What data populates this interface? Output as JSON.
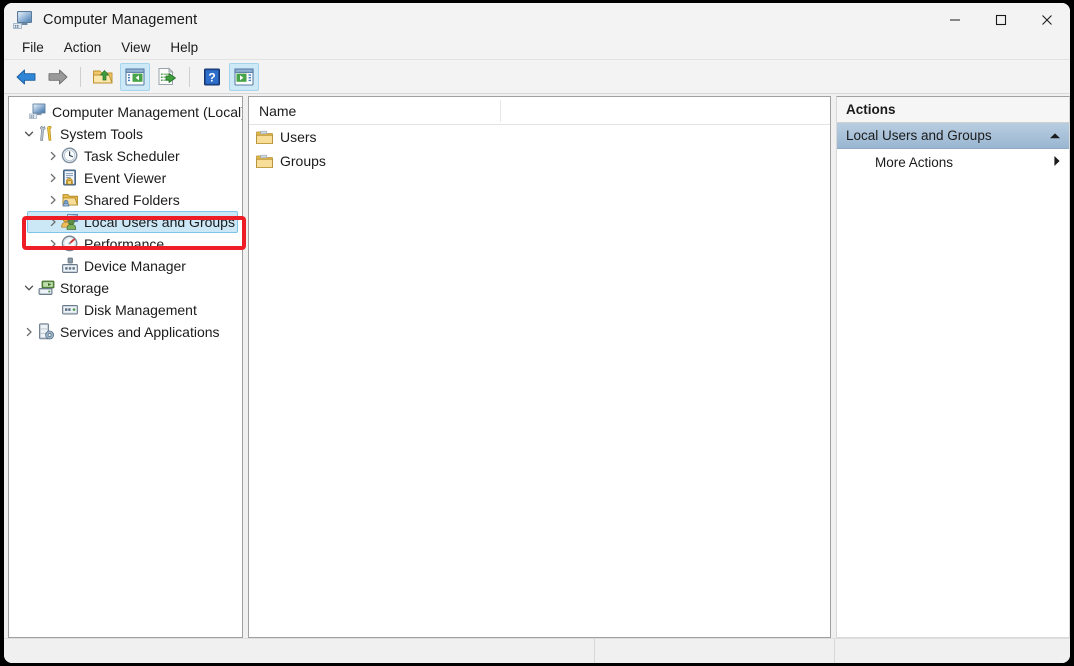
{
  "window": {
    "title": "Computer Management",
    "app_icon": "computer-management-icon",
    "controls": {
      "minimize": "—",
      "maximize": "□",
      "close": "✕"
    }
  },
  "menubar": {
    "items": [
      {
        "label": "File"
      },
      {
        "label": "Action"
      },
      {
        "label": "View"
      },
      {
        "label": "Help"
      }
    ]
  },
  "toolbar": {
    "buttons": [
      {
        "name": "back-icon",
        "active": false
      },
      {
        "name": "forward-icon",
        "active": false
      },
      {
        "name": "up-folder-icon",
        "active": false
      },
      {
        "name": "show-hide-console-tree-icon",
        "active": true
      },
      {
        "name": "export-list-icon",
        "active": false
      },
      {
        "name": "help-icon",
        "active": false
      },
      {
        "name": "show-hide-action-pane-icon",
        "active": true
      }
    ]
  },
  "tree": {
    "nodes": [
      {
        "label": "Computer Management (Local)",
        "icon": "computer-icon",
        "depth": 0,
        "twist": "none",
        "selected": false
      },
      {
        "label": "System Tools",
        "icon": "system-tools-icon",
        "depth": 1,
        "twist": "expanded",
        "selected": false
      },
      {
        "label": "Task Scheduler",
        "icon": "clock-icon",
        "depth": 2,
        "twist": "collapsed",
        "selected": false
      },
      {
        "label": "Event Viewer",
        "icon": "event-viewer-icon",
        "depth": 2,
        "twist": "collapsed",
        "selected": false
      },
      {
        "label": "Shared Folders",
        "icon": "shared-folders-icon",
        "depth": 2,
        "twist": "collapsed",
        "selected": false
      },
      {
        "label": "Local Users and Groups",
        "icon": "users-group-icon",
        "depth": 2,
        "twist": "collapsed",
        "selected": true
      },
      {
        "label": "Performance",
        "icon": "performance-gauge-icon",
        "depth": 2,
        "twist": "collapsed",
        "selected": false
      },
      {
        "label": "Device Manager",
        "icon": "device-manager-icon",
        "depth": 2,
        "twist": "none",
        "selected": false
      },
      {
        "label": "Storage",
        "icon": "storage-icon",
        "depth": 1,
        "twist": "expanded",
        "selected": false
      },
      {
        "label": "Disk Management",
        "icon": "disk-icon",
        "depth": 2,
        "twist": "none",
        "selected": false
      },
      {
        "label": "Services and Applications",
        "icon": "services-icon",
        "depth": 1,
        "twist": "collapsed",
        "selected": false
      }
    ]
  },
  "list": {
    "columns": [
      {
        "label": "Name"
      }
    ],
    "rows": [
      {
        "name": "Users",
        "icon": "folder-icon"
      },
      {
        "name": "Groups",
        "icon": "folder-icon"
      }
    ]
  },
  "actions": {
    "header": "Actions",
    "group": {
      "label": "Local Users and Groups",
      "collapse_icon": "chevron-up-icon"
    },
    "items": [
      {
        "label": "More Actions",
        "submenu_icon": "triangle-right-icon"
      }
    ]
  },
  "annotation": {
    "target": "Local Users and Groups",
    "color": "#ee1c25"
  }
}
